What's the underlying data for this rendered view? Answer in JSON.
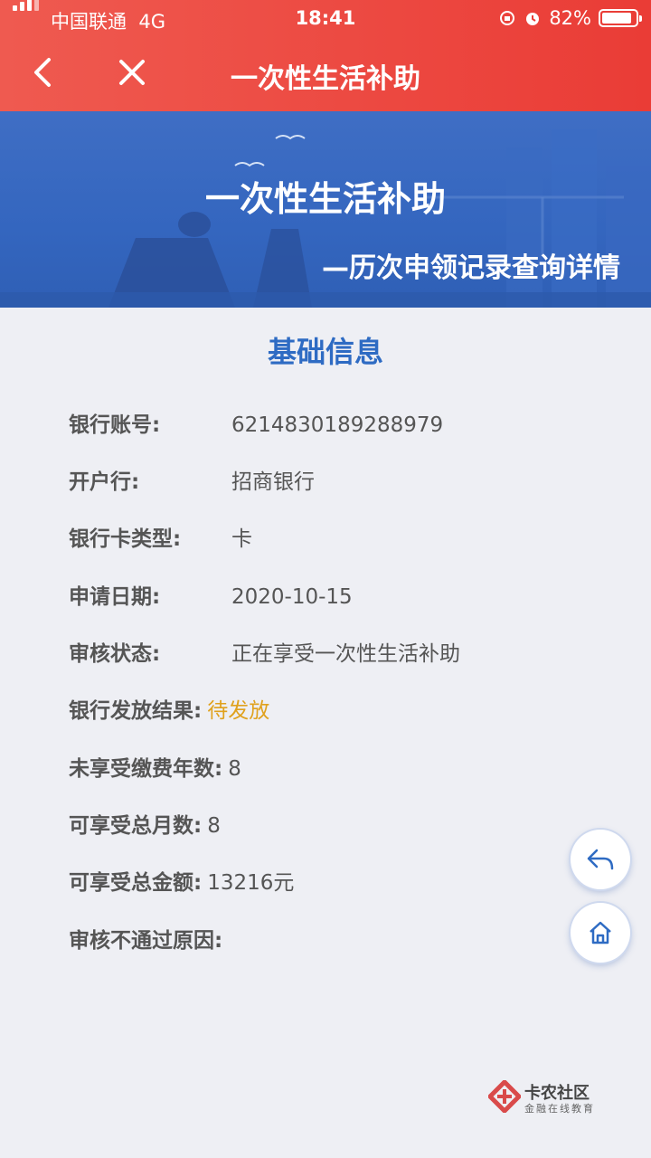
{
  "status": {
    "carrier": "中国联通",
    "network": "4G",
    "time": "18:41",
    "battery": "82%"
  },
  "nav": {
    "title": "一次性生活补助"
  },
  "banner": {
    "title": "一次性生活补助",
    "subtitle": "—历次申领记录查询详情"
  },
  "section": {
    "title": "基础信息"
  },
  "fields": [
    {
      "label": "银行账号:",
      "value": "6214830189288979"
    },
    {
      "label": "开户行:",
      "value": "招商银行"
    },
    {
      "label": "银行卡类型:",
      "value": "卡"
    },
    {
      "label": "申请日期:",
      "value": "2020-10-15"
    },
    {
      "label": "审核状态:",
      "value": "正在享受一次性生活补助"
    },
    {
      "label": "银行发放结果:",
      "value": "待发放"
    },
    {
      "label": "未享受缴费年数:",
      "value": "8"
    },
    {
      "label": "可享受总月数:",
      "value": "8"
    },
    {
      "label": "可享受总金额:",
      "value": "13216元"
    },
    {
      "label": "审核不通过原因:",
      "value": ""
    }
  ],
  "watermark": {
    "name": "卡农社区",
    "tagline": "金融在线教育"
  },
  "icons": [
    "back-icon",
    "close-icon",
    "reply-icon",
    "home-icon",
    "alarm-icon",
    "rotation-lock-icon",
    "battery-icon",
    "signal-icon"
  ],
  "colors": {
    "header": "#ea3c36",
    "banner": "#3466bf",
    "section_title": "#2e6bc3",
    "pending": "#e0a11d"
  }
}
